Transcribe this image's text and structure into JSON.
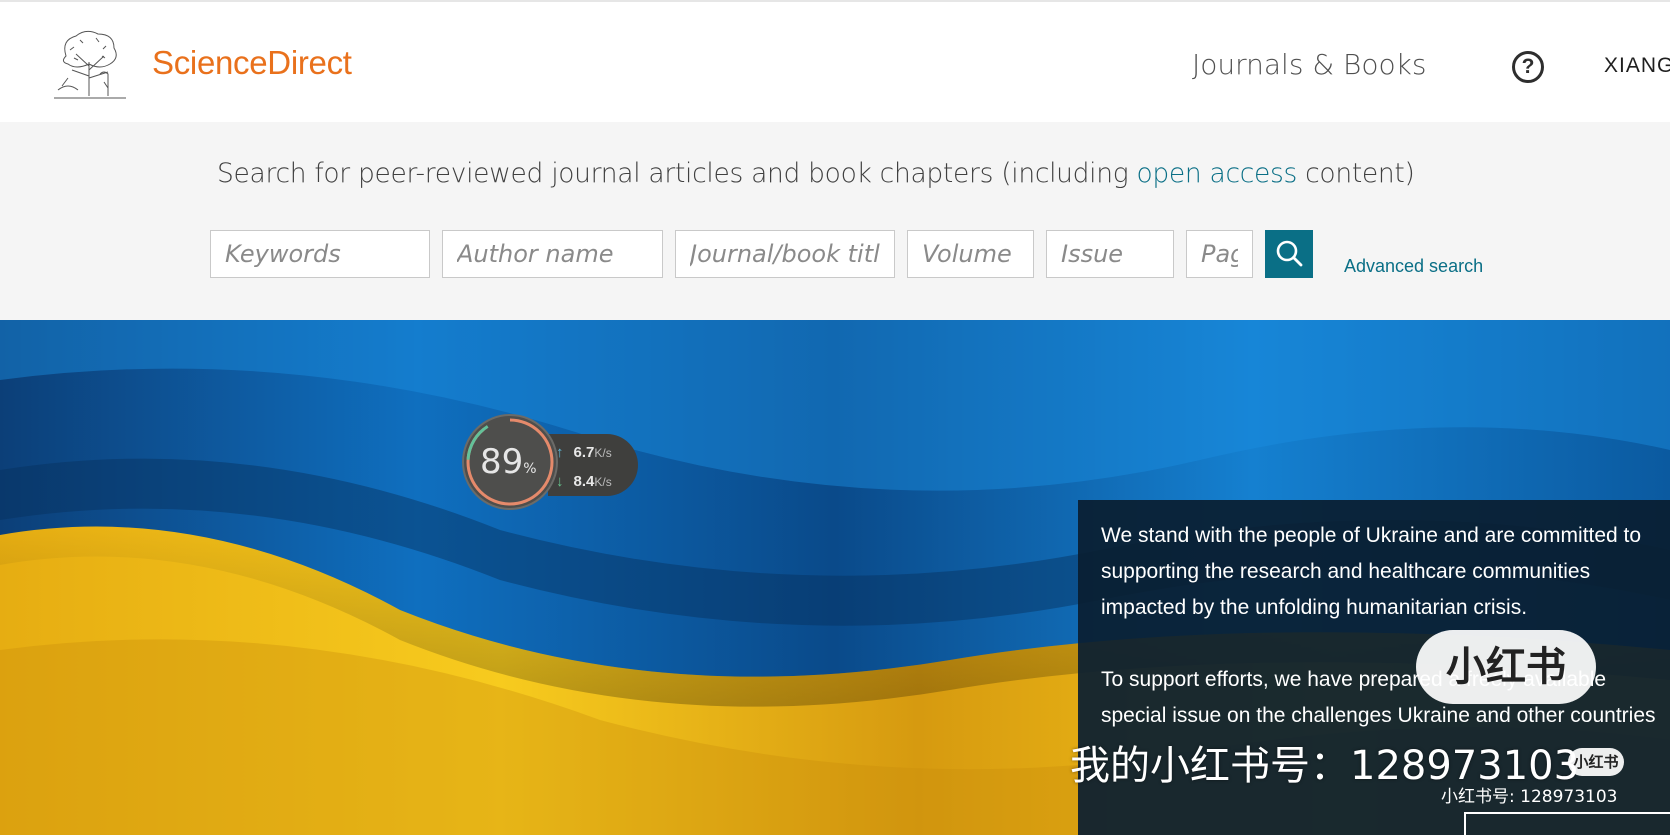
{
  "header": {
    "brand": "ScienceDirect",
    "nav_journals": "Journals & Books",
    "help_glyph": "?",
    "user_name": "XIANG"
  },
  "search": {
    "intro_before": "Search for peer-reviewed journal articles and book chapters (including ",
    "intro_link": "open access",
    "intro_after": " content)",
    "fields": {
      "keywords": "Keywords",
      "author": "Author name",
      "journal": "Journal/book title",
      "volume": "Volume",
      "issue": "Issue",
      "pages": "Pages"
    },
    "advanced_label": "Advanced search"
  },
  "banner": {
    "text_lines_1": [
      "We stand with the people of Ukraine and are committed to",
      "supporting the research and healthcare communities",
      "impacted by the unfolding humanitarian crisis."
    ],
    "text_lines_2": [
      "To support efforts, we have prepared a freely available",
      "special issue on the challenges Ukraine and other countries"
    ]
  },
  "speed_widget": {
    "percent": "89",
    "percent_unit": "%",
    "upload": "6.7",
    "download": "8.4",
    "unit": "K/s"
  },
  "watermark": {
    "badge": "小红书",
    "big": "我的小红书号：128973103",
    "small_badge": "小红书",
    "small": "小红书号: 128973103"
  },
  "colors": {
    "brand_orange": "#e9711c",
    "link_teal": "#0a6f86",
    "flag_blue": "#0f72c4",
    "flag_yellow": "#f5c518"
  }
}
